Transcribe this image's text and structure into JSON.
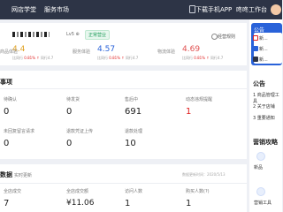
{
  "topbar": {
    "nav_shop": "网店学堂",
    "nav_market": "服务市场",
    "download": "下载手机APP",
    "workbench": "咚咚工作台"
  },
  "shop": {
    "level": "Lv5 ⊕",
    "status": "正常营业",
    "rules": "经营规则"
  },
  "scores": [
    {
      "label": "商品体验",
      "value": "4.4",
      "sub_a": "比同行 ",
      "sub_b": "0.81% ↑",
      "sub_c": " 同行4.7"
    },
    {
      "label": "服务体验",
      "value": "4.57",
      "sub_a": "比同行 ",
      "sub_b": "0.81% ↑",
      "sub_c": " 同行4.7"
    },
    {
      "label": "物流体验",
      "value": "4.69",
      "sub_a": "比同行 ",
      "sub_b": "0.81% ↑",
      "sub_c": " 同行4.7"
    }
  ],
  "todo": {
    "title": "事项",
    "items": [
      {
        "label": "待确认",
        "value": "0"
      },
      {
        "label": "待发货",
        "value": "0"
      },
      {
        "label": "售后中",
        "value": "691"
      },
      {
        "label": "动态违规提醒",
        "value": "1"
      },
      {
        "label": "未回复留言请求",
        "value": "0"
      },
      {
        "label": "退款凭证上传",
        "value": "0"
      },
      {
        "label": "退款处理",
        "value": "10"
      }
    ]
  },
  "data_section": {
    "title": "数据",
    "note": "实时更新",
    "update": "数据更新时间：2020/5/13",
    "items": [
      {
        "label": "全店成交",
        "value": "7"
      },
      {
        "label": "全店成交额",
        "value": "¥11.06"
      },
      {
        "label": "访问人数",
        "value": "1"
      },
      {
        "label": "购买人数(?)",
        "value": "1"
      }
    ]
  },
  "sidebar": {
    "head": "公告",
    "rows": [
      "新...",
      "新...",
      "新..."
    ],
    "announce_title": "公告",
    "announce": [
      "1 商品管理工具",
      "2 关于店铺",
      "3 重要通知"
    ],
    "marketing": "营销攻略",
    "icons": [
      "新品",
      "营销工具"
    ]
  }
}
